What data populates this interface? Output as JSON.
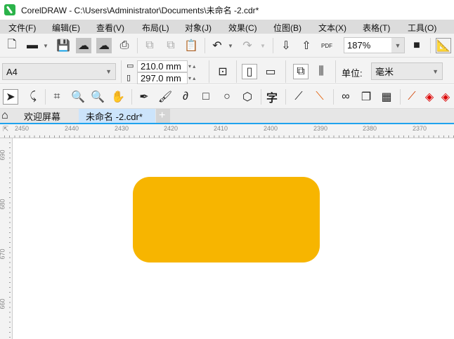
{
  "title": "CorelDRAW - C:\\Users\\Administrator\\Documents\\未命名 -2.cdr*",
  "menu": [
    "文件(F)",
    "编辑(E)",
    "查看(V)",
    "布局(L)",
    "对象(J)",
    "效果(C)",
    "位图(B)",
    "文本(X)",
    "表格(T)",
    "工具(O)"
  ],
  "toolbar": {
    "zoom": "187%",
    "pdf_label": "PDF"
  },
  "property_bar": {
    "page_size": "A4",
    "width": "210.0 mm",
    "height": "297.0 mm",
    "units_label": "单位:",
    "units": "毫米"
  },
  "toolbox": {
    "text_tool": "字"
  },
  "tabs": [
    {
      "label": "欢迎屏幕"
    },
    {
      "label": "未命名 -2.cdr*"
    }
  ],
  "ruler": {
    "h": [
      "2450",
      "2440",
      "2430",
      "2420",
      "2410",
      "2400",
      "2390",
      "2380",
      "2370"
    ],
    "v": [
      "690",
      "680",
      "670",
      "660"
    ]
  },
  "shape": {
    "fill": "#f7b500"
  },
  "colors": {
    "accent": "#1fa3ee",
    "tab_active": "#cce4fb"
  }
}
